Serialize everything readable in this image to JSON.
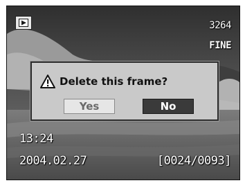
{
  "osd": {
    "mode_icon": "playback-icon",
    "frame_count": "3264",
    "quality": "FINE",
    "time": "13:24",
    "date": "2004.02.27",
    "frame_index": "[0024/0093]"
  },
  "dialog": {
    "icon": "warning-icon",
    "message": "Delete this frame?",
    "yes_label": "Yes",
    "no_label": "No",
    "selected": "No"
  },
  "colors": {
    "dialog_bg": "#c9c9c9",
    "selected_button": "#3a3a3a",
    "unselected_button": "#e6e6e6"
  }
}
